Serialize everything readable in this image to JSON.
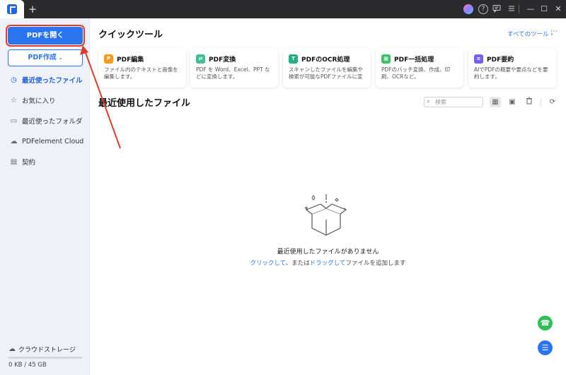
{
  "titlebar": {
    "new_tab_label": "+",
    "icons": [
      "avatar-icon",
      "help-icon",
      "chat-icon",
      "menu-icon"
    ],
    "help_glyph": "?",
    "window_buttons": {
      "minimize": "—",
      "maximize": "☐",
      "close": "✕"
    }
  },
  "sidebar": {
    "open_pdf_label": "PDFを開く",
    "create_pdf_label": "PDF作成",
    "create_chevron": "⌄",
    "items": [
      {
        "label": "最近使ったファイル",
        "icon": "clock-check-icon",
        "glyph": "◷",
        "active": true
      },
      {
        "label": "お気に入り",
        "icon": "star-icon",
        "glyph": "☆",
        "active": false
      },
      {
        "label": "最近使ったフォルダ",
        "icon": "folder-icon",
        "glyph": "▭",
        "active": false
      },
      {
        "label": "PDFelement Cloud",
        "icon": "cloud-icon",
        "glyph": "☁",
        "active": false
      },
      {
        "label": "契約",
        "icon": "contract-icon",
        "glyph": "▤",
        "active": false
      }
    ],
    "storage": {
      "label": "クラウドストレージ",
      "usage_text": "0 KB / 45 GB",
      "used_fraction": 0
    }
  },
  "main": {
    "quick_tools_title": "クイックツール",
    "all_tools_link": "すべてのツール  ›",
    "more_glyph": "⋯",
    "cards": [
      {
        "title": "PDF編集",
        "desc": "ファイル内のテキストと画像を編集します。",
        "icon": "edit-icon",
        "color": "#f59b1e",
        "glyph": "P"
      },
      {
        "title": "PDF変換",
        "desc": "PDF を Word、Excel、PPT などに変換します。",
        "icon": "convert-icon",
        "color": "#3fbf8f",
        "glyph": "⇄"
      },
      {
        "title": "PDFのOCR処理",
        "desc": "スキャンしたファイルを編集や検索が可能なPDFファイルに変換...",
        "icon": "ocr-icon",
        "color": "#22b07d",
        "glyph": "T"
      },
      {
        "title": "PDF一括処理",
        "desc": "PDFのバッチ変換、作成、印刷、OCRなど。",
        "icon": "batch-icon",
        "color": "#3cc16b",
        "glyph": "▦"
      },
      {
        "title": "PDF要約",
        "desc": "AIでPDFの概要や要点などを要約します。",
        "icon": "summary-icon",
        "color": "#7b5cf0",
        "glyph": "≡"
      }
    ],
    "recent_title": "最近使用したファイル",
    "search_placeholder": "検索",
    "view_icons": {
      "list": "▦",
      "grid": "▣",
      "trash": "🗑",
      "refresh": "⟳"
    },
    "empty_message": "最近使用したファイルがありません",
    "empty_hint": {
      "link1": "クリックして",
      "text1": "、または",
      "link2": "ドラッグして",
      "text2": "ファイルを追加します"
    },
    "fab_support_glyph": "☎",
    "fab_tools_glyph": "☰"
  },
  "annotation": {
    "arrow_color": "#e03b2b",
    "arrow_target": "open-pdf-button"
  }
}
